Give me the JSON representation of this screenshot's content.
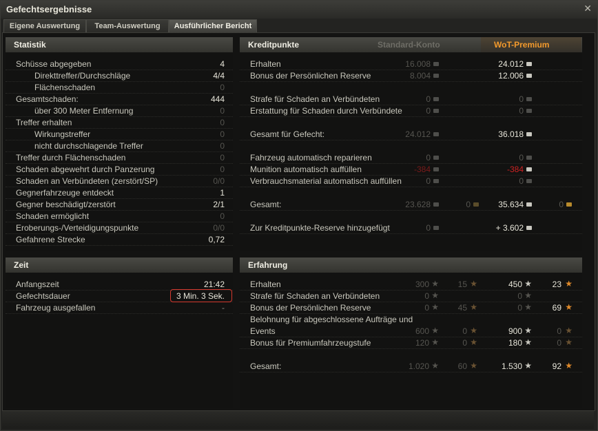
{
  "window": {
    "title": "Gefechtsergebnisse",
    "close": "✕"
  },
  "tabs": [
    {
      "label": "Eigene Auswertung"
    },
    {
      "label": "Team-Auswertung"
    },
    {
      "label": "Ausführlicher Bericht",
      "active": true
    }
  ],
  "statistik": {
    "title": "Statistik",
    "rows": [
      {
        "label": "Schüsse abgegeben",
        "value": "4"
      },
      {
        "label": "Direkttreffer/Durchschläge",
        "value": "4/4"
      },
      {
        "label": "Flächenschaden",
        "value": "0"
      },
      {
        "label": "Gesamtschaden:",
        "value": "444"
      },
      {
        "label": "über 300 Meter Entfernung",
        "value": "0"
      },
      {
        "label": "Treffer erhalten",
        "value": "0"
      },
      {
        "label": "Wirkungstreffer",
        "value": "0"
      },
      {
        "label": "nicht durchschlagende Treffer",
        "value": "0"
      },
      {
        "label": "Treffer durch Flächenschaden",
        "value": "0"
      },
      {
        "label": "Schaden abgewehrt durch Panzerung",
        "value": "0"
      },
      {
        "label": "Schaden an Verbündeten (zerstört/SP)",
        "value": "0/0"
      },
      {
        "label": "Gegnerfahrzeuge entdeckt",
        "value": "1"
      },
      {
        "label": "Gegner beschädigt/zerstört",
        "value": "2/1"
      },
      {
        "label": "Schaden ermöglicht",
        "value": "0"
      },
      {
        "label": "Eroberungs-/Verteidigungspunkte",
        "value": "0/0"
      },
      {
        "label": "Gefahrene Strecke",
        "value": "0,72"
      }
    ]
  },
  "zeit": {
    "title": "Zeit",
    "rows": [
      {
        "label": "Anfangszeit",
        "value": "21:42"
      },
      {
        "label": "Gefechtsdauer",
        "value": "3 Min. 3 Sek."
      },
      {
        "label": "Fahrzeug ausgefallen",
        "value": "-"
      }
    ]
  },
  "kredit": {
    "title": "Kreditpunkte",
    "col_standard": "Standard-Konto",
    "col_premium": "WoT-Premium",
    "rows": [
      {
        "label": "Erhalten",
        "std": "16.008",
        "prem": "24.012"
      },
      {
        "label": "Bonus der Persönlichen Reserve",
        "std": "8.004",
        "prem": "12.006"
      },
      {
        "label": "Strafe für Schaden an Verbündeten",
        "std": "0",
        "prem": "0"
      },
      {
        "label": "Erstattung für Schaden durch Verbündete",
        "std": "0",
        "prem": "0"
      },
      {
        "label": "Gesamt für Gefecht:",
        "std": "24.012",
        "prem": "36.018"
      },
      {
        "label": "Fahrzeug automatisch reparieren",
        "std": "0",
        "prem": "0"
      },
      {
        "label": "Munition automatisch auffüllen",
        "std": "-384",
        "prem": "-384"
      },
      {
        "label": "Verbrauchsmaterial automatisch auffüllen",
        "std": "0",
        "prem": "0"
      },
      {
        "label": "Gesamt:",
        "std": "23.628",
        "std_gold": "0",
        "prem": "35.634",
        "prem_gold": "0"
      },
      {
        "label": "Zur Kreditpunkte-Reserve hinzugefügt",
        "std": "0",
        "prem": "+ 3.602"
      }
    ]
  },
  "erfahrung": {
    "title": "Erfahrung",
    "rows": [
      {
        "label": "Erhalten",
        "std": "300",
        "std_f": "15",
        "prem": "450",
        "prem_f": "23"
      },
      {
        "label": "Strafe für Schaden an Verbündeten",
        "std": "0",
        "prem": "0"
      },
      {
        "label": "Bonus der Persönlichen Reserve",
        "std": "0",
        "std_f": "45",
        "prem": "0",
        "prem_f": "69"
      },
      {
        "label": "Belohnung für abgeschlossene Aufträge und",
        "label2": "Events",
        "std": "600",
        "std_f": "0",
        "prem": "900",
        "prem_f": "0"
      },
      {
        "label": "Bonus für Premiumfahrzeugstufe",
        "std": "120",
        "std_f": "0",
        "prem": "180",
        "prem_f": "0"
      },
      {
        "label": "Gesamt:",
        "std": "1.020",
        "std_f": "60",
        "prem": "1.530",
        "prem_f": "92"
      }
    ]
  }
}
